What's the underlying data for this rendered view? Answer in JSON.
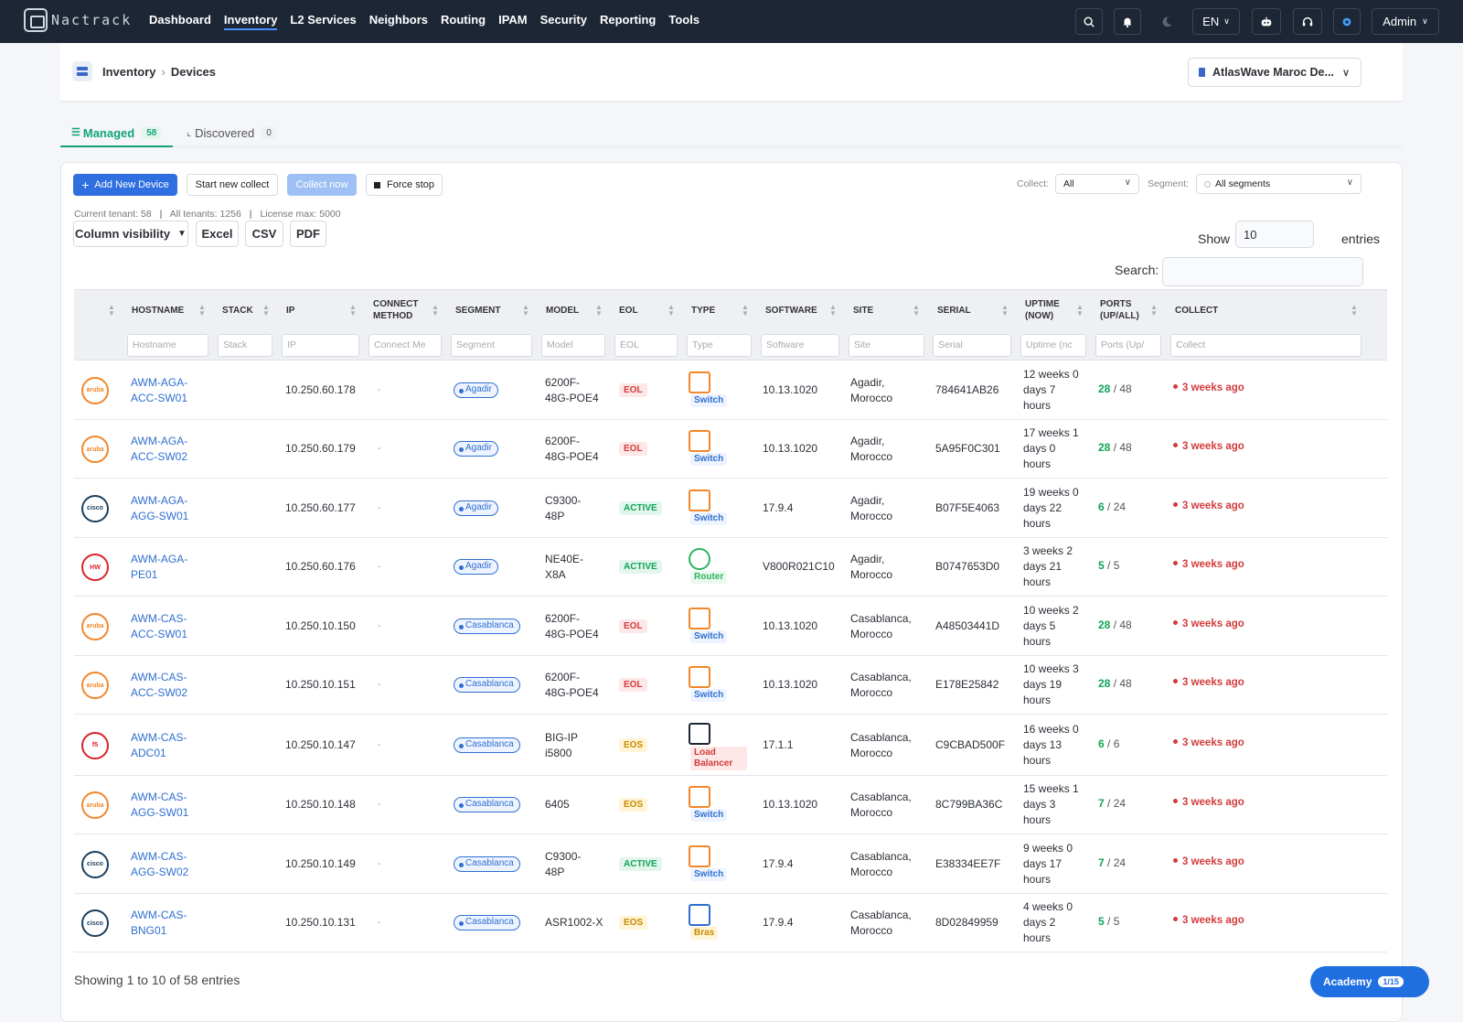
{
  "app": {
    "name": "Nactrack"
  },
  "nav": [
    "Dashboard",
    "Inventory",
    "L2 Services",
    "Neighbors",
    "Routing",
    "IPAM",
    "Security",
    "Reporting",
    "Tools"
  ],
  "topbar": {
    "lang": "EN",
    "user": "Admin"
  },
  "breadcrumb": {
    "root": "Inventory",
    "current": "Devices"
  },
  "tenant": "AtlasWave Maroc De...",
  "tabs": {
    "managed": {
      "label": "Managed",
      "count": "58"
    },
    "discovered": {
      "label": "Discovered",
      "count": "0"
    }
  },
  "toolbar": {
    "add": "Add New Device",
    "start": "Start new collect",
    "collect_now": "Collect now",
    "force_stop": "Force stop",
    "collect_label": "Collect:",
    "collect_value": "All",
    "segment_label": "Segment:",
    "segment_value": "All segments"
  },
  "counts": {
    "current": "Current tenant: 58",
    "all": "All tenants: 1256",
    "license": "License max: 5000"
  },
  "export": {
    "colvis": "Column visibility",
    "excel": "Excel",
    "csv": "CSV",
    "pdf": "PDF"
  },
  "length": {
    "show": "Show",
    "value": "10",
    "entries": "entries"
  },
  "search_label": "Search:",
  "columns": [
    "HOSTNAME",
    "STACK",
    "IP",
    "CONNECT METHOD",
    "SEGMENT",
    "MODEL",
    "EOL",
    "TYPE",
    "SOFTWARE",
    "SITE",
    "SERIAL",
    "UPTIME (NOW)",
    "PORTS (UP/ALL)",
    "COLLECT"
  ],
  "filters": [
    "Hostname",
    "Stack",
    "IP",
    "Connect Me",
    "Segment",
    "Model",
    "EOL",
    "Type",
    "Software",
    "Site",
    "Serial",
    "Uptime (nc",
    "Ports (Up/",
    "Collect"
  ],
  "rows": [
    {
      "vendor": "aruba",
      "host1": "AWM-AGA-",
      "host2": "ACC-SW01",
      "ip": "10.250.60.178",
      "conn": "-",
      "seg": "Agadir",
      "m1": "6200F-",
      "m2": "48G-POE4",
      "eol": "EOL",
      "type": "Switch",
      "sw": "10.13.1020",
      "s1": "Agadir,",
      "s2": "Morocco",
      "serial": "784641AB26",
      "u1": "12 weeks 0",
      "u2": "days 7",
      "u3": "hours",
      "up": "28",
      "all": "/ 48",
      "collect": "3 weeks ago"
    },
    {
      "vendor": "aruba",
      "host1": "AWM-AGA-",
      "host2": "ACC-SW02",
      "ip": "10.250.60.179",
      "conn": "-",
      "seg": "Agadir",
      "m1": "6200F-",
      "m2": "48G-POE4",
      "eol": "EOL",
      "type": "Switch",
      "sw": "10.13.1020",
      "s1": "Agadir,",
      "s2": "Morocco",
      "serial": "5A95F0C301",
      "u1": "17 weeks 1",
      "u2": "days 0",
      "u3": "hours",
      "up": "28",
      "all": "/ 48",
      "collect": "3 weeks ago"
    },
    {
      "vendor": "cisco",
      "host1": "AWM-AGA-",
      "host2": "AGG-SW01",
      "ip": "10.250.60.177",
      "conn": "-",
      "seg": "Agadir",
      "m1": "C9300-",
      "m2": "48P",
      "eol": "ACTIVE",
      "type": "Switch",
      "sw": "17.9.4",
      "s1": "Agadir,",
      "s2": "Morocco",
      "serial": "B07F5E4063",
      "u1": "19 weeks 0",
      "u2": "days 22",
      "u3": "hours",
      "up": "6",
      "all": "/ 24",
      "collect": "3 weeks ago"
    },
    {
      "vendor": "huawei",
      "host1": "AWM-AGA-",
      "host2": "PE01",
      "ip": "10.250.60.176",
      "conn": "-",
      "seg": "Agadir",
      "m1": "NE40E-",
      "m2": "X8A",
      "eol": "ACTIVE",
      "type": "Router",
      "sw": "V800R021C10",
      "s1": "Agadir,",
      "s2": "Morocco",
      "serial": "B0747653D0",
      "u1": "3 weeks 2",
      "u2": "days 21",
      "u3": "hours",
      "up": "5",
      "all": "/ 5",
      "collect": "3 weeks ago"
    },
    {
      "vendor": "aruba",
      "host1": "AWM-CAS-",
      "host2": "ACC-SW01",
      "ip": "10.250.10.150",
      "conn": "-",
      "seg": "Casablanca",
      "m1": "6200F-",
      "m2": "48G-POE4",
      "eol": "EOL",
      "type": "Switch",
      "sw": "10.13.1020",
      "s1": "Casablanca,",
      "s2": "Morocco",
      "serial": "A48503441D",
      "u1": "10 weeks 2",
      "u2": "days 5",
      "u3": "hours",
      "up": "28",
      "all": "/ 48",
      "collect": "3 weeks ago"
    },
    {
      "vendor": "aruba",
      "host1": "AWM-CAS-",
      "host2": "ACC-SW02",
      "ip": "10.250.10.151",
      "conn": "-",
      "seg": "Casablanca",
      "m1": "6200F-",
      "m2": "48G-POE4",
      "eol": "EOL",
      "type": "Switch",
      "sw": "10.13.1020",
      "s1": "Casablanca,",
      "s2": "Morocco",
      "serial": "E178E25842",
      "u1": "10 weeks 3",
      "u2": "days 19",
      "u3": "hours",
      "up": "28",
      "all": "/ 48",
      "collect": "3 weeks ago"
    },
    {
      "vendor": "f5",
      "host1": "AWM-CAS-",
      "host2": "ADC01",
      "ip": "10.250.10.147",
      "conn": "-",
      "seg": "Casablanca",
      "m1": "BIG-IP",
      "m2": "i5800",
      "eol": "EOS",
      "type": "Load Balancer",
      "sw": "17.1.1",
      "s1": "Casablanca,",
      "s2": "Morocco",
      "serial": "C9CBAD500F",
      "u1": "16 weeks 0",
      "u2": "days 13",
      "u3": "hours",
      "up": "6",
      "all": "/ 6",
      "collect": "3 weeks ago"
    },
    {
      "vendor": "aruba",
      "host1": "AWM-CAS-",
      "host2": "AGG-SW01",
      "ip": "10.250.10.148",
      "conn": "-",
      "seg": "Casablanca",
      "m1": "6405",
      "m2": "",
      "eol": "EOS",
      "type": "Switch",
      "sw": "10.13.1020",
      "s1": "Casablanca,",
      "s2": "Morocco",
      "serial": "8C799BA36C",
      "u1": "15 weeks 1",
      "u2": "days 3",
      "u3": "hours",
      "up": "7",
      "all": "/ 24",
      "collect": "3 weeks ago"
    },
    {
      "vendor": "cisco",
      "host1": "AWM-CAS-",
      "host2": "AGG-SW02",
      "ip": "10.250.10.149",
      "conn": "-",
      "seg": "Casablanca",
      "m1": "C9300-",
      "m2": "48P",
      "eol": "ACTIVE",
      "type": "Switch",
      "sw": "17.9.4",
      "s1": "Casablanca,",
      "s2": "Morocco",
      "serial": "E38334EE7F",
      "u1": "9 weeks 0",
      "u2": "days 17",
      "u3": "hours",
      "up": "7",
      "all": "/ 24",
      "collect": "3 weeks ago"
    },
    {
      "vendor": "cisco",
      "host1": "AWM-CAS-",
      "host2": "BNG01",
      "ip": "10.250.10.131",
      "conn": "-",
      "seg": "Casablanca",
      "m1": "ASR1002-X",
      "m2": "",
      "eol": "EOS",
      "type": "Bras",
      "sw": "17.9.4",
      "s1": "Casablanca,",
      "s2": "Morocco",
      "serial": "8D02849959",
      "u1": "4 weeks 0",
      "u2": "days 2",
      "u3": "hours",
      "up": "5",
      "all": "/ 5",
      "collect": "3 weeks ago"
    }
  ],
  "footer": "Showing 1 to 10 of 58 entries",
  "academy": {
    "label": "Academy",
    "progress": "1/15"
  },
  "colors": {
    "topbar": "#1d2634",
    "accent": "#2f6fe0",
    "success": "#12a37a",
    "danger": "#d23b3b"
  }
}
